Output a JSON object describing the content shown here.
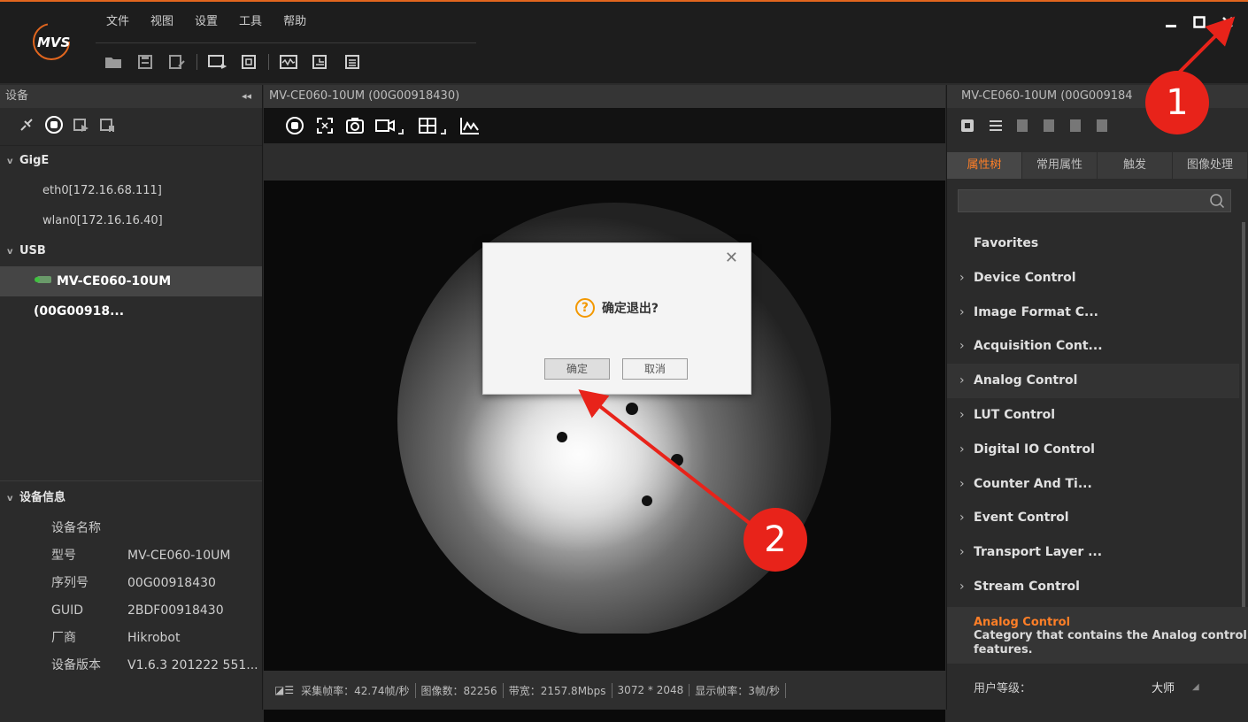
{
  "menu": {
    "items": [
      "文件",
      "视图",
      "设置",
      "工具",
      "帮助"
    ]
  },
  "left_panel": {
    "title": "设备",
    "groups": [
      {
        "label": "GigE",
        "items": [
          "eth0[172.16.68.111]",
          "wlan0[172.16.16.40]"
        ]
      },
      {
        "label": "USB",
        "items": [
          "MV-CE060-10UM (00G00918..."
        ]
      }
    ],
    "device_info": {
      "title": "设备信息",
      "rows": [
        {
          "key": "设备名称",
          "value": ""
        },
        {
          "key": "型号",
          "value": "MV-CE060-10UM"
        },
        {
          "key": "序列号",
          "value": "00G00918430"
        },
        {
          "key": "GUID",
          "value": "2BDF00918430"
        },
        {
          "key": "厂商",
          "value": "Hikrobot"
        },
        {
          "key": "设备版本",
          "value": "V1.6.3 201222 551..."
        }
      ]
    }
  },
  "center": {
    "tab_title": "MV-CE060-10UM (00G00918430)",
    "status": {
      "acq_fps": "采集帧率：42.74帧/秒",
      "image_count": "图像数：82256",
      "bandwidth": "带宽：2157.8Mbps",
      "resolution": "3072 * 2048",
      "display_fps": "显示帧率：3帧/秒"
    }
  },
  "dialog": {
    "message": "确定退出?",
    "ok_label": "确定",
    "cancel_label": "取消",
    "question_glyph": "?"
  },
  "right_panel": {
    "title": "MV-CE060-10UM (00G009184",
    "tabs": [
      "属性树",
      "常用属性",
      "触发",
      "图像处理"
    ],
    "active_tab": "属性树",
    "favorites": "Favorites",
    "properties": [
      "Device Control",
      "Image Format C...",
      "Acquisition Cont...",
      "Analog Control",
      "LUT Control",
      "Digital IO Control",
      "Counter And Ti...",
      "Event Control",
      "Transport Layer ...",
      "Stream Control"
    ],
    "description": {
      "title": "Analog Control",
      "text": "Category that contains the Analog control features."
    },
    "user_level_label": "用户等级：",
    "user_level_value": "大师"
  },
  "annotations": {
    "badge_1": "1",
    "badge_2": "2"
  },
  "colors": {
    "accent": "#ff7f27",
    "annotation": "#e8231a",
    "question": "#f39800"
  }
}
